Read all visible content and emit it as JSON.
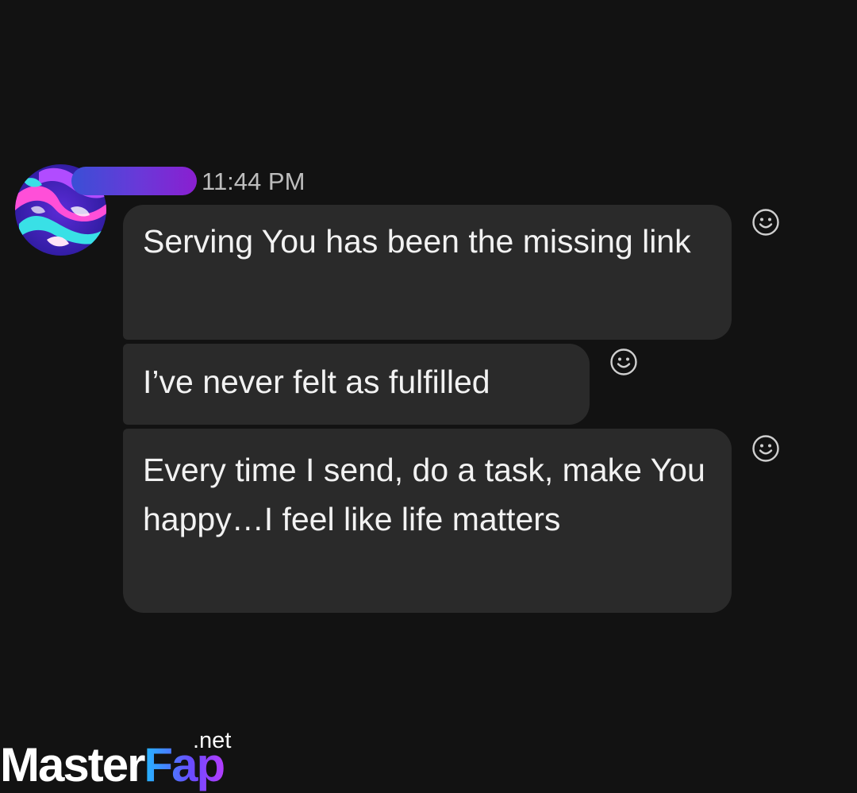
{
  "message_group": {
    "timestamp": "11:44 PM",
    "sender": {
      "avatar_icon": "abstract-swirl-avatar",
      "name_redaction_colors": [
        "#3a4fd6",
        "#8a1fd0"
      ]
    },
    "messages": [
      {
        "text": "Serving You has been the missing link",
        "reaction_icon": "smiley-reaction-icon"
      },
      {
        "text": "I’ve never felt as fulfilled",
        "reaction_icon": "smiley-reaction-icon"
      },
      {
        "text": "Every time I send, do a task, make You happy…I feel like life matters",
        "reaction_icon": "smiley-reaction-icon"
      }
    ]
  },
  "watermark": {
    "brand_part1": "Master",
    "brand_part2": "Fap",
    "tld": ".net"
  },
  "colors": {
    "background": "#121212",
    "bubble": "#2a2a2a",
    "message_text": "#f2f2f2",
    "timestamp_text": "#bdbdbd"
  }
}
